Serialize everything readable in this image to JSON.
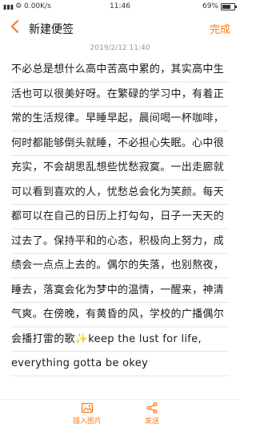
{
  "status": {
    "signal_text": "⚙ 0.00K/s",
    "time": "11:46",
    "battery": "69%",
    "battery_level": 0.69
  },
  "header": {
    "title": "新建便签",
    "done_label": "完成"
  },
  "note": {
    "timestamp": "2019/2/12 11:40",
    "body": "不必总是想什么高中苦高中累的，其实高中生活也可以很美好呀。在繁碌的学习中，有着正常的生活规律。早睡早起，晨间喝一杯咖啡，何时都能够倒头就睡，不必担心失眠。心中很充实，不会胡思乱想些忧愁寂寞。一出走廊就可以看到喜欢的人，忧愁总会化为笑颜。每天都可以在自己的日历上打勾勾，日子一天天的过去了。保持平和的心态，积极向上努力，成绩会一点点上去的。偶尔的失落，也别熬夜，睡去，落寞会化为梦中的温情，一醒来，神清气爽。在傍晚，有黄昏的风，学校的广播偶尔会播打雷的歌✨keep the lust for life,\neverything gotta be okey"
  },
  "toolbar": {
    "insert_image_label": "插入图片",
    "send_label": "发送"
  },
  "colors": {
    "accent": "#ff7a1a"
  }
}
